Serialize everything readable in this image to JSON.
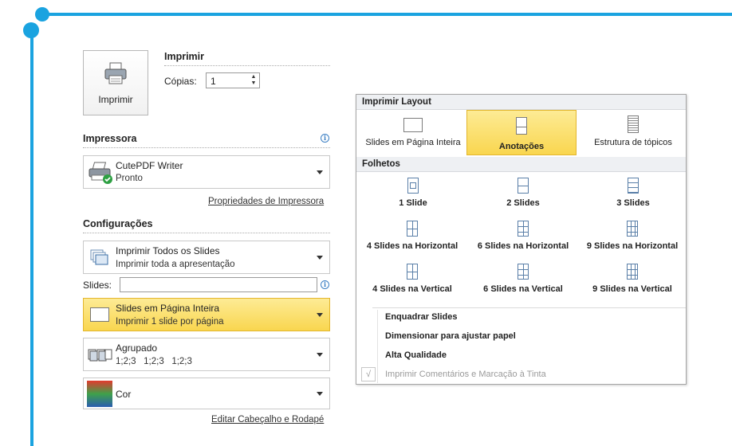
{
  "print": {
    "button_label": "Imprimir",
    "title": "Imprimir",
    "copies_label": "Cópias:",
    "copies_value": "1"
  },
  "printer": {
    "section_title": "Impressora",
    "name": "CutePDF Writer",
    "status": "Pronto",
    "properties_link": "Propriedades de Impressora"
  },
  "settings": {
    "section_title": "Configurações",
    "range": {
      "title": "Imprimir Todos os Slides",
      "subtitle": "Imprimir toda a apresentação"
    },
    "slides_label": "Slides:",
    "slides_value": "",
    "layout": {
      "title": "Slides em Página Inteira",
      "subtitle": "Imprimir 1 slide por página"
    },
    "collate": {
      "title": "Agrupado",
      "subtitle": "1;2;3   1;2;3   1;2;3"
    },
    "color": {
      "title": "Cor"
    },
    "header_footer_link": "Editar Cabeçalho e Rodapé"
  },
  "layout_menu": {
    "layout_header": "Imprimir Layout",
    "layout_options": [
      "Slides em Página Inteira",
      "Anotações",
      "Estrutura de tópicos"
    ],
    "selected": "Anotações",
    "handouts_header": "Folhetos",
    "handouts": [
      "1 Slide",
      "2 Slides",
      "3 Slides",
      "4 Slides na Horizontal",
      "6 Slides na Horizontal",
      "9 Slides na Horizontal",
      "4 Slides na Vertical",
      "6 Slides na Vertical",
      "9 Slides na Vertical"
    ],
    "items": [
      {
        "label": "Enquadrar Slides",
        "enabled": true
      },
      {
        "label": "Dimensionar para ajustar papel",
        "enabled": true
      },
      {
        "label": "Alta Qualidade",
        "enabled": true
      },
      {
        "label": "Imprimir Comentários e Marcação à Tinta",
        "enabled": false
      }
    ]
  },
  "colors": {
    "accent": "#1aa3e0",
    "selected": "#f9d64f"
  }
}
